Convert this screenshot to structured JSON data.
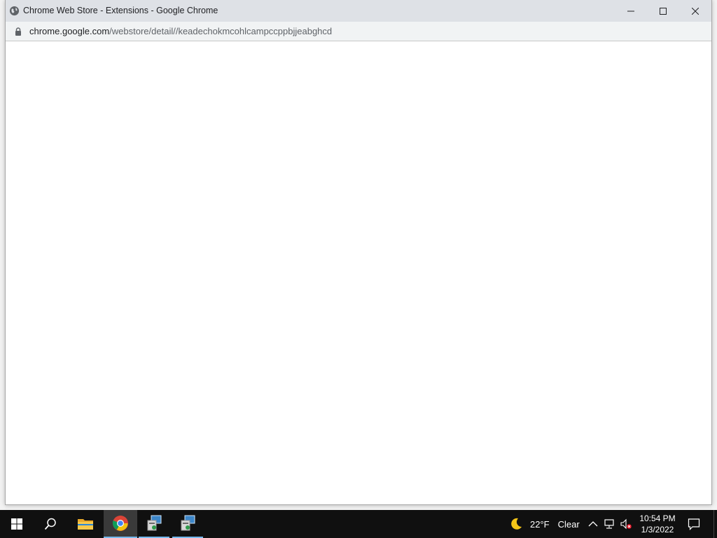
{
  "window": {
    "title": "Chrome Web Store - Extensions - Google Chrome",
    "url_host": "chrome.google.com",
    "url_path": "/webstore/detail//keadechokmcohlcampccppbjjeabghcd",
    "title_icon": "globe-icon"
  },
  "taskbar": {
    "apps": [
      {
        "name": "Start",
        "icon": "windows-logo-icon"
      },
      {
        "name": "Search",
        "icon": "search-icon"
      },
      {
        "name": "File Explorer",
        "icon": "folder-icon"
      },
      {
        "name": "Google Chrome",
        "icon": "chrome-icon",
        "active": true
      },
      {
        "name": "App",
        "icon": "installer-icon"
      },
      {
        "name": "App",
        "icon": "installer-icon"
      }
    ],
    "weather": {
      "temp": "22°F",
      "condition": "Clear",
      "icon": "moon-icon"
    },
    "clock": {
      "time": "10:54 PM",
      "date": "1/3/2022"
    }
  },
  "colors": {
    "titlebar": "#dee1e6",
    "addressbar": "#f1f3f4",
    "taskbar": "#101010",
    "accent": "#76b9ed"
  }
}
